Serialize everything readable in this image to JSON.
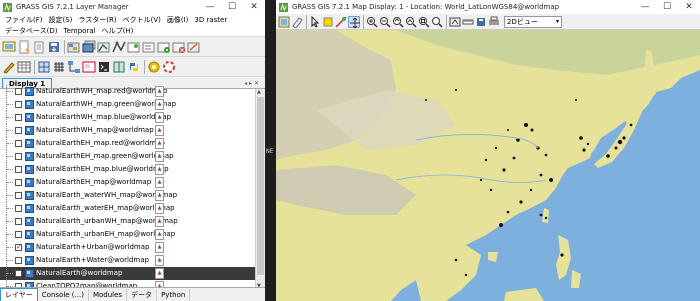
{
  "layer_manager": {
    "title": "GRASS GIS 7.2.1 Layer Manager",
    "window_controls": {
      "minimize": "—",
      "maximize": "☐",
      "close": "✕"
    },
    "menu": [
      "ファイル(F)",
      "設定(S)",
      "ラスター(R)",
      "ベクトル(V)",
      "画像(I)",
      "3D raster",
      "データベース(D)",
      "Temporal",
      "ヘルプ(H)"
    ],
    "display_tab": "Display 1",
    "display_tab_controls": "◂ ▸ ✕",
    "layers": [
      {
        "name": "NaturalEarthWH_map.red@worldmap",
        "checked": false
      },
      {
        "name": "NaturalEarthWH_map.green@worldmap",
        "checked": false
      },
      {
        "name": "NaturalEarthWH_map.blue@worldmap",
        "checked": false
      },
      {
        "name": "NaturalEarthWH_map@worldmap",
        "checked": false
      },
      {
        "name": "NaturalEarthEH_map.red@worldmap",
        "checked": false
      },
      {
        "name": "NaturalEarthEH_map.green@worldmap",
        "checked": false
      },
      {
        "name": "NaturalEarthEH_map.blue@worldmap",
        "checked": false
      },
      {
        "name": "NaturalEarthEH_map@worldmap",
        "checked": false
      },
      {
        "name": "NaturalEarth_waterWH_map@worldmap",
        "checked": false
      },
      {
        "name": "NaturalEarth_waterEH_map@worldmap",
        "checked": false
      },
      {
        "name": "NaturalEarth_urbanWH_map@worldmap",
        "checked": false
      },
      {
        "name": "NaturalEarth_urbanEH_map@worldmap",
        "checked": false
      },
      {
        "name": "NaturalEarth+Urban@worldmap",
        "checked": true
      },
      {
        "name": "NaturalEarth+Water@worldmap",
        "checked": false
      },
      {
        "name": "NaturalEarth@worldmap",
        "checked": false,
        "selected": true
      },
      {
        "name": "CleanTOPO2map@worldmap",
        "checked": false
      }
    ],
    "bottom_tabs": [
      "レイヤー",
      "Console (...)",
      "Modules",
      "データ",
      "Python"
    ],
    "active_bottom_tab": "レイヤー"
  },
  "gap_text": "NE",
  "map_display": {
    "title": "GRASS GIS 7.2.1 Map Display: 1 - Location: World_LatLonWGS84@worldmap",
    "window_controls": {
      "minimize": "—",
      "maximize": "☐",
      "close": "✕"
    },
    "view_mode": "2Dビュー"
  },
  "colors": {
    "ocean": "#7eb0de",
    "land_green": "#e8e49a",
    "land_desert": "#d8d4b8",
    "selection": "#3a3a3a",
    "accent": "#3a96c9"
  }
}
